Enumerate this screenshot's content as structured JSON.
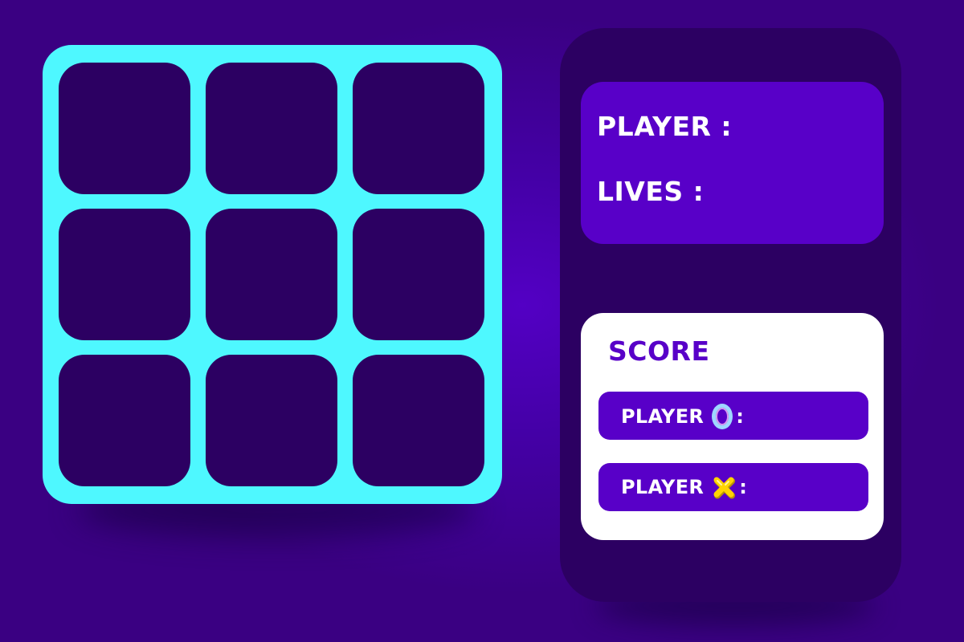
{
  "board": {
    "rows": 3,
    "cols": 3,
    "cells": [
      "",
      "",
      "",
      "",
      "",
      "",
      "",
      "",
      ""
    ]
  },
  "info": {
    "player_label": "PLAYER :",
    "lives_label": "LIVES :"
  },
  "score": {
    "title": "SCORE",
    "player_o_label": "PLAYER",
    "player_x_label": "PLAYER",
    "separator": ":"
  },
  "icons": {
    "o": "o-token-icon",
    "x": "x-token-icon"
  },
  "colors": {
    "board_frame": "#4ef8ff",
    "cell": "#2c0062",
    "panel": "#2c0062",
    "accent": "#5800c8",
    "score_card": "#ffffff",
    "x_token": "#ffd400"
  }
}
